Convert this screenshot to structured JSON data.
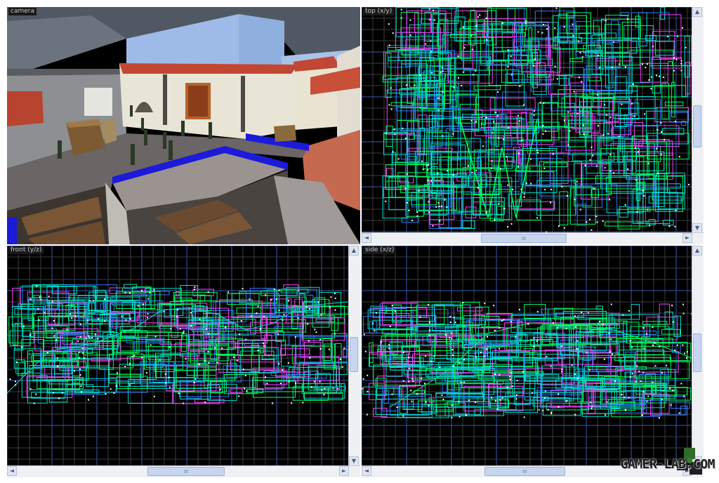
{
  "viewports": {
    "camera": {
      "label": "camera"
    },
    "top": {
      "label": "top (x/y)"
    },
    "front": {
      "label": "front (y/z)"
    },
    "side": {
      "label": "side (x/z)"
    }
  },
  "scroll": {
    "up": "▲",
    "down": "▼",
    "left": "◄",
    "right": "►",
    "grip": "III"
  },
  "watermark": {
    "text": "GAMER-LAB.COM"
  },
  "colors": {
    "grid_major": "#3a5ab0",
    "grid_minor": "#3b3b3b",
    "brush_cyan": "#00e0d0",
    "brush_green": "#00ff60",
    "brush_blue": "#2f7dff",
    "brush_magenta": "#ff3cff",
    "vertex_white": "#ffffff",
    "wall_red": "#b84a38",
    "sky": "#9dbbe6",
    "floor": "#6a6464"
  }
}
